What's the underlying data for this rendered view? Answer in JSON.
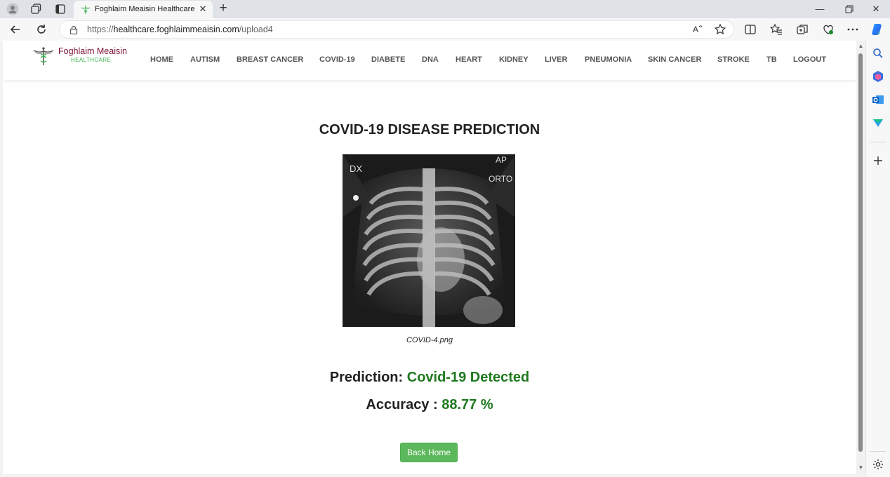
{
  "browser": {
    "tab_title": "Foghlaim Meaisin Healthcare",
    "url_prefix": "https://",
    "url_host": "healthcare.foghlaimmeaisin.com",
    "url_path": "/upload4",
    "new_tab_symbol": "+",
    "close_symbol": "✕"
  },
  "site": {
    "brand_name": "Foghlaim Meaisin",
    "brand_sub": "HEALTHCARE",
    "nav": [
      "HOME",
      "AUTISM",
      "BREAST CANCER",
      "COVID-19",
      "DIABETE",
      "DNA",
      "HEART",
      "KIDNEY",
      "LIVER",
      "PNEUMONIA",
      "SKIN CANCER",
      "STROKE",
      "TB",
      "LOGOUT"
    ]
  },
  "main": {
    "title": "COVID-19 DISEASE PREDICTION",
    "image_caption": "COVID-4.png",
    "xray_label_left": "DX",
    "xray_label_right_top": "AP",
    "xray_label_right": "ORTO",
    "prediction_label": "Prediction:",
    "prediction_value": "Covid-19 Detected",
    "accuracy_label": "Accuracy :",
    "accuracy_value": "88.77 %",
    "back_button": "Back Home"
  },
  "colors": {
    "result_green": "#1f7a1f",
    "button_green": "#5cb85c",
    "brand_maroon": "#7b1030"
  }
}
